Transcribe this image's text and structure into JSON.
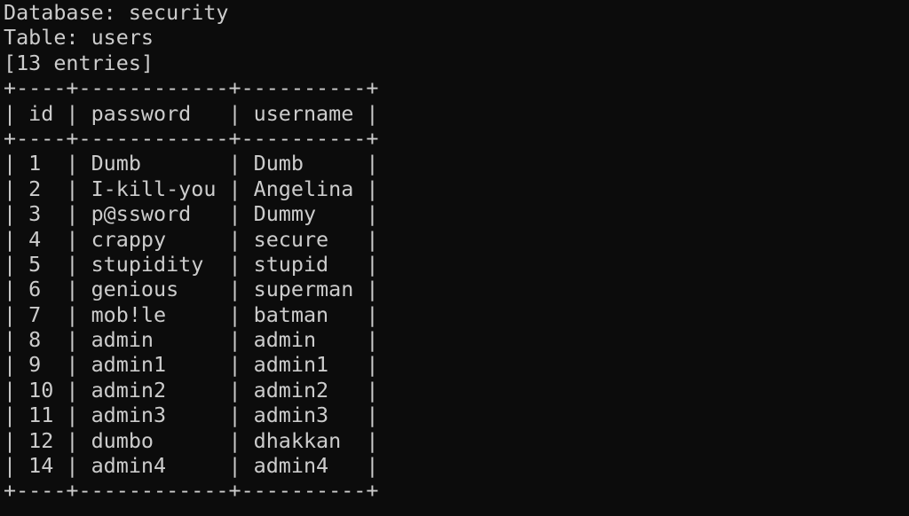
{
  "header": {
    "database_line": "Database: security",
    "table_line": "Table: users",
    "entries_line": "[13 entries]"
  },
  "table": {
    "border": "+----+------------+----------+",
    "header_row": "| id | password   | username |",
    "rows": [
      "| 1  | Dumb       | Dumb     |",
      "| 2  | I-kill-you | Angelina |",
      "| 3  | p@ssword   | Dummy    |",
      "| 4  | crappy     | secure   |",
      "| 5  | stupidity  | stupid   |",
      "| 6  | genious    | superman |",
      "| 7  | mob!le     | batman   |",
      "| 8  | admin      | admin    |",
      "| 9  | admin1     | admin1   |",
      "| 10 | admin2     | admin2   |",
      "| 11 | admin3     | admin3   |",
      "| 12 | dumbo      | dhakkan  |",
      "| 14 | admin4     | admin4   |"
    ],
    "columns": [
      "id",
      "password",
      "username"
    ],
    "records": [
      {
        "id": "1",
        "password": "Dumb",
        "username": "Dumb"
      },
      {
        "id": "2",
        "password": "I-kill-you",
        "username": "Angelina"
      },
      {
        "id": "3",
        "password": "p@ssword",
        "username": "Dummy"
      },
      {
        "id": "4",
        "password": "crappy",
        "username": "secure"
      },
      {
        "id": "5",
        "password": "stupidity",
        "username": "stupid"
      },
      {
        "id": "6",
        "password": "genious",
        "username": "superman"
      },
      {
        "id": "7",
        "password": "mob!le",
        "username": "batman"
      },
      {
        "id": "8",
        "password": "admin",
        "username": "admin"
      },
      {
        "id": "9",
        "password": "admin1",
        "username": "admin1"
      },
      {
        "id": "10",
        "password": "admin2",
        "username": "admin2"
      },
      {
        "id": "11",
        "password": "admin3",
        "username": "admin3"
      },
      {
        "id": "12",
        "password": "dumbo",
        "username": "dhakkan"
      },
      {
        "id": "14",
        "password": "admin4",
        "username": "admin4"
      }
    ]
  },
  "colors": {
    "background": "#0c0c0c",
    "text": "#cccccc"
  }
}
